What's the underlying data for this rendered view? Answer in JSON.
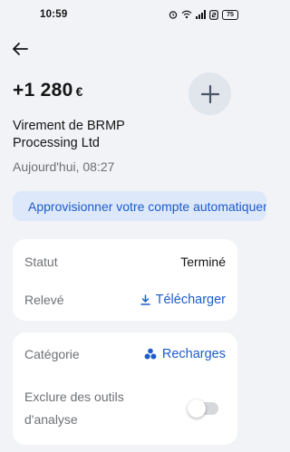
{
  "status_bar": {
    "time": "10:59",
    "battery": "75"
  },
  "transaction": {
    "amount": "+1 280",
    "currency": "€",
    "merchant": "Virement de BRMP Processing Ltd",
    "datetime": "Aujourd'hui, 08:27"
  },
  "promo": {
    "label": "Approvisionner votre compte automatiquement"
  },
  "details": {
    "statut_label": "Statut",
    "statut_value": "Terminé",
    "releve_label": "Relevé",
    "releve_action": "Télécharger"
  },
  "category": {
    "label": "Catégorie",
    "value": "Recharges",
    "exclude_label": "Exclure des outils d'analyse",
    "exclude_enabled": false
  },
  "colors": {
    "accent": "#1d5ccb",
    "background": "#f2f3f6",
    "chip": "#dde8fa"
  }
}
